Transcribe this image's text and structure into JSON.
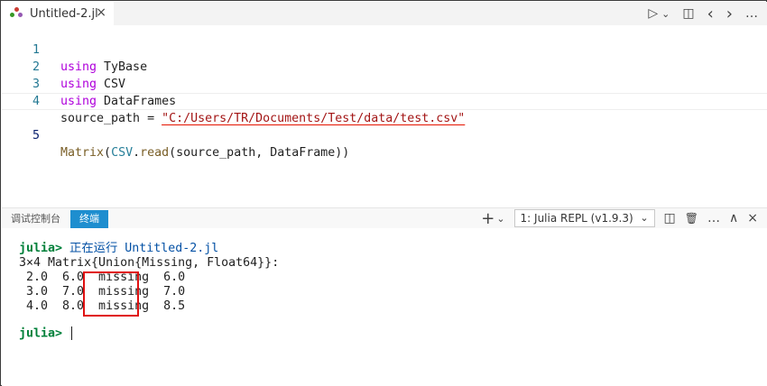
{
  "tab": {
    "filename": "Untitled-2.jl",
    "close": "×"
  },
  "toolbar": {
    "run": "▷",
    "run_menu": "⌄",
    "split": "◫",
    "back": "‹",
    "forward": "›",
    "more": "…"
  },
  "editor": {
    "lines": [
      {
        "number": "1",
        "keyword": "using",
        "rest": " TyBase"
      },
      {
        "number": "2",
        "keyword": "using",
        "rest": " CSV"
      },
      {
        "number": "3",
        "keyword": "using",
        "rest": " DataFrames"
      },
      {
        "number": "4",
        "lhs": "source_path = ",
        "string": "\"C:/Users/TR/Documents/Test/data/test.csv\""
      },
      {
        "number": "5",
        "fn1": "Matrix",
        "p1": "(",
        "ty": "CSV",
        "dot": ".",
        "fn2": "read",
        "args": "(source_path, DataFrame))"
      }
    ]
  },
  "panel": {
    "tabs": [
      {
        "label": "调试控制台"
      },
      {
        "label": "终端"
      }
    ],
    "terminal_select": "1: Julia REPL (v1.9.3)",
    "icons": {
      "add": "+",
      "add_menu": "⌄",
      "select_chevron": "⌄",
      "split": "◫",
      "trash": "🗑",
      "more": "…",
      "maximize": "∧",
      "close": "×"
    }
  },
  "terminal": {
    "prompt": "julia>",
    "running_text": " 正在运行 Untitled-2.jl",
    "header": "3×4 Matrix{Union{Missing, Float64}}:",
    "rows": [
      " 2.0  6.0  missing  6.0",
      " 3.0  7.0  missing  7.0",
      " 4.0  8.0  missing  8.5"
    ]
  },
  "colors": {
    "highlight_box": "#e01010",
    "active_panel_tab": "#1e8ecf"
  }
}
